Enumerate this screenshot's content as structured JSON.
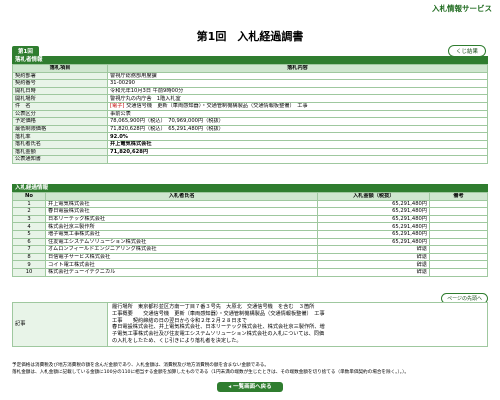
{
  "header": {
    "service_title": "入札情報サービス",
    "page_title": "第1回　入札経過調書",
    "round_tab": "第1回",
    "nav_button": "くじ結果"
  },
  "bid_info": {
    "section_title": "落札者情報",
    "col_item": "落札項目",
    "col_content": "落札内容",
    "rows": [
      {
        "label": "契約部署",
        "value": "警視庁総務部用度課"
      },
      {
        "label": "契約番号",
        "value": "31-00290"
      },
      {
        "label": "開札日時",
        "value": "令和元年10月3日 午前9時00分"
      },
      {
        "label": "開札場所",
        "value": "警視庁丸の内庁舎　1階入札室"
      },
      {
        "label": "件　名",
        "prefix": "[電子]",
        "value": " 交通信号機　更新（車両感知器）・交通管制機構製品（交通情報板整備）　工事"
      },
      {
        "label": "公表区分",
        "value": "事前公表"
      },
      {
        "label": "予定価格",
        "value": "78,065,900円（税込）　70,969,000円（税抜）"
      },
      {
        "label": "最低制限価格",
        "value": "71,820,628円（税込）　65,291,480円（税抜）"
      },
      {
        "label": "落札率",
        "value": "92.0%"
      },
      {
        "label": "落札者氏名",
        "value": "井上電気株式会社"
      },
      {
        "label": "落札金額",
        "value": "71,820,628円"
      },
      {
        "label": "公表通知書",
        "value": ""
      }
    ]
  },
  "bid_list": {
    "section_title": "入札経過情報",
    "col_no": "No",
    "col_name": "入札者氏名",
    "col_amount": "入札金額（税抜）",
    "col_note": "備考",
    "rows": [
      {
        "no": "1",
        "name": "井上電気株式会社",
        "amount": "65,291,480円",
        "note": ""
      },
      {
        "no": "2",
        "name": "春日電設株式会社",
        "amount": "65,291,480円",
        "note": ""
      },
      {
        "no": "3",
        "name": "日本リーテック株式会社",
        "amount": "65,291,480円",
        "note": ""
      },
      {
        "no": "4",
        "name": "株式会社京三製作所",
        "amount": "65,291,480円",
        "note": ""
      },
      {
        "no": "5",
        "name": "増子電気工事株式会社",
        "amount": "65,291,480円",
        "note": ""
      },
      {
        "no": "6",
        "name": "住友電工システムソリューション株式会社",
        "amount": "65,291,480円",
        "note": ""
      },
      {
        "no": "7",
        "name": "オムロンフィールドエンジニアリング株式会社",
        "amount": "辞退",
        "note": ""
      },
      {
        "no": "8",
        "name": "日信電子サービス株式会社",
        "amount": "辞退",
        "note": ""
      },
      {
        "no": "9",
        "name": "コイト電工株式会社",
        "amount": "辞退",
        "note": ""
      },
      {
        "no": "10",
        "name": "株式会社デューイテクニカル",
        "amount": "辞退",
        "note": ""
      }
    ]
  },
  "page_top_button": "ページの先頭へ",
  "remarks": {
    "label": "記事",
    "text": "履行場所　東京都杉並区方南一丁目７番３号先　大原北　交通信号機　を含む　３箇所\n工事概要　　交通信号機　更新（車両感知器）・交通管制機構製品（交通情報板整備）　工事\n工事　　契約締結の日の翌日から令和２年２月２８日まで\n春日電設株式会社、井上電気株式会社、日本リーテック株式会社、株式会社京三製作所、増\n子電気工事株式会社及び住友電工システムソリューション株式会社の入札については、同価\nの入札をしたため、くじ引きにより落札者を決定した。"
  },
  "footnotes": [
    "予定価格は消費税及び地方消費税の額を含んだ金額であり、入札金額は、消費税及び地方消費税の額を含まない金額である。",
    "落札金額は、入札金額に記載している金額に100分の110に相当する金額を加算したものである（1円未満の端数が生じたときは、その端数金額を切り捨てる（単数単価契約の場合を除く。）。）。"
  ],
  "back_button": "◂ 一覧画面へ戻る",
  "colors": {
    "accent": "#2f7d2f",
    "header_fill": "#cfe6cf",
    "label_fill": "#e8f4e8",
    "prefix": "#c00000"
  }
}
